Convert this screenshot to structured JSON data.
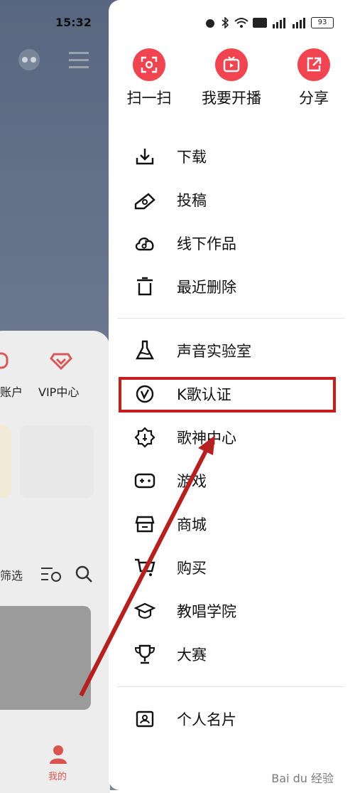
{
  "status": {
    "time": "15:32",
    "battery": "93"
  },
  "background": {
    "account_label": "账户",
    "vip_label": "VIP中心",
    "filter_label": "筛选",
    "tab_mine": "我的"
  },
  "quick_actions": [
    {
      "label": "扫一扫",
      "icon": "scan-icon"
    },
    {
      "label": "我要开播",
      "icon": "live-tv-icon"
    },
    {
      "label": "分享",
      "icon": "share-icon"
    }
  ],
  "menu_group1": [
    {
      "label": "下载",
      "icon": "download-icon"
    },
    {
      "label": "投稿",
      "icon": "contribute-icon"
    },
    {
      "label": "线下作品",
      "icon": "cloud-music-icon"
    },
    {
      "label": "最近删除",
      "icon": "trash-icon"
    }
  ],
  "menu_group2": [
    {
      "label": "声音实验室",
      "icon": "flask-icon"
    },
    {
      "label": "K歌认证",
      "icon": "verified-icon"
    },
    {
      "label": "歌神中心",
      "icon": "badge-icon"
    },
    {
      "label": "游戏",
      "icon": "gamepad-icon"
    },
    {
      "label": "商城",
      "icon": "store-icon"
    },
    {
      "label": "购买",
      "icon": "cart-icon"
    },
    {
      "label": "教唱学院",
      "icon": "graduation-cap-icon"
    },
    {
      "label": "大赛",
      "icon": "trophy-icon"
    }
  ],
  "menu_group3": [
    {
      "label": "个人名片",
      "icon": "id-card-icon"
    }
  ],
  "watermark": "Bai du 经验",
  "accent_color": "#f04451",
  "annotation_color": "#c41e1e"
}
